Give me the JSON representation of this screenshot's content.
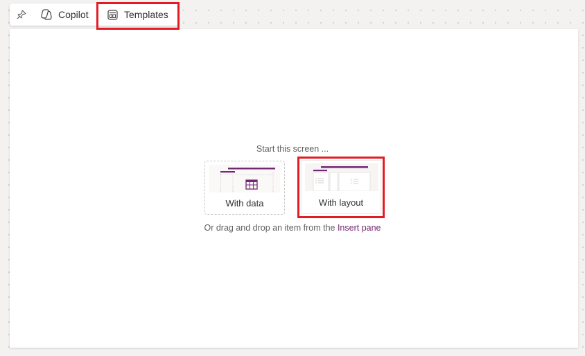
{
  "toolbar": {
    "pin_icon": "pin-icon",
    "copilot": {
      "label": "Copilot",
      "icon": "copilot-icon"
    },
    "templates": {
      "label": "Templates",
      "icon": "templates-icon"
    }
  },
  "canvas": {
    "start_title": "Start this screen ...",
    "cards": [
      {
        "label": "With data",
        "thumbnail": "table-icon"
      },
      {
        "label": "With layout",
        "thumbnail": "layout-preview"
      }
    ],
    "helper_text": "Or drag and drop an item from the ",
    "helper_link": "Insert pane"
  },
  "colors": {
    "accent": "#742774",
    "highlight": "#e31b23",
    "canvas_bg": "#ffffff",
    "workspace_bg": "#f3f2f1"
  }
}
